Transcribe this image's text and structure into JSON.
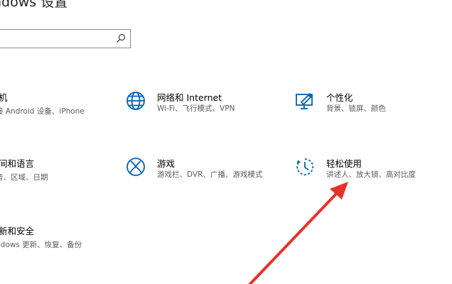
{
  "window": {
    "title": "ndows 设置"
  },
  "search": {
    "placeholder": "",
    "value": ""
  },
  "tiles": [
    {
      "name": "机",
      "desc": "接 Android 设备、iPhone",
      "icon": "phone-icon"
    },
    {
      "name": "网络和 Internet",
      "desc": "Wi-Fi、飞行模式、VPN",
      "icon": "globe-icon"
    },
    {
      "name": "个性化",
      "desc": "背景、锁屏、颜色",
      "icon": "personalization-icon"
    },
    {
      "name": "间和语言",
      "desc": "音、区域、日期",
      "icon": "time-language-icon"
    },
    {
      "name": "游戏",
      "desc": "游戏栏、DVR、广播、游戏模式",
      "icon": "xbox-icon"
    },
    {
      "name": "轻松使用",
      "desc": "讲述人、放大镜、高对比度",
      "icon": "ease-of-access-icon"
    },
    {
      "name": "新和安全",
      "desc": "ndows 更新、恢复、备份",
      "icon": "update-security-icon"
    }
  ],
  "colors": {
    "accent": "#0063b1",
    "arrow": "#e8312a"
  }
}
